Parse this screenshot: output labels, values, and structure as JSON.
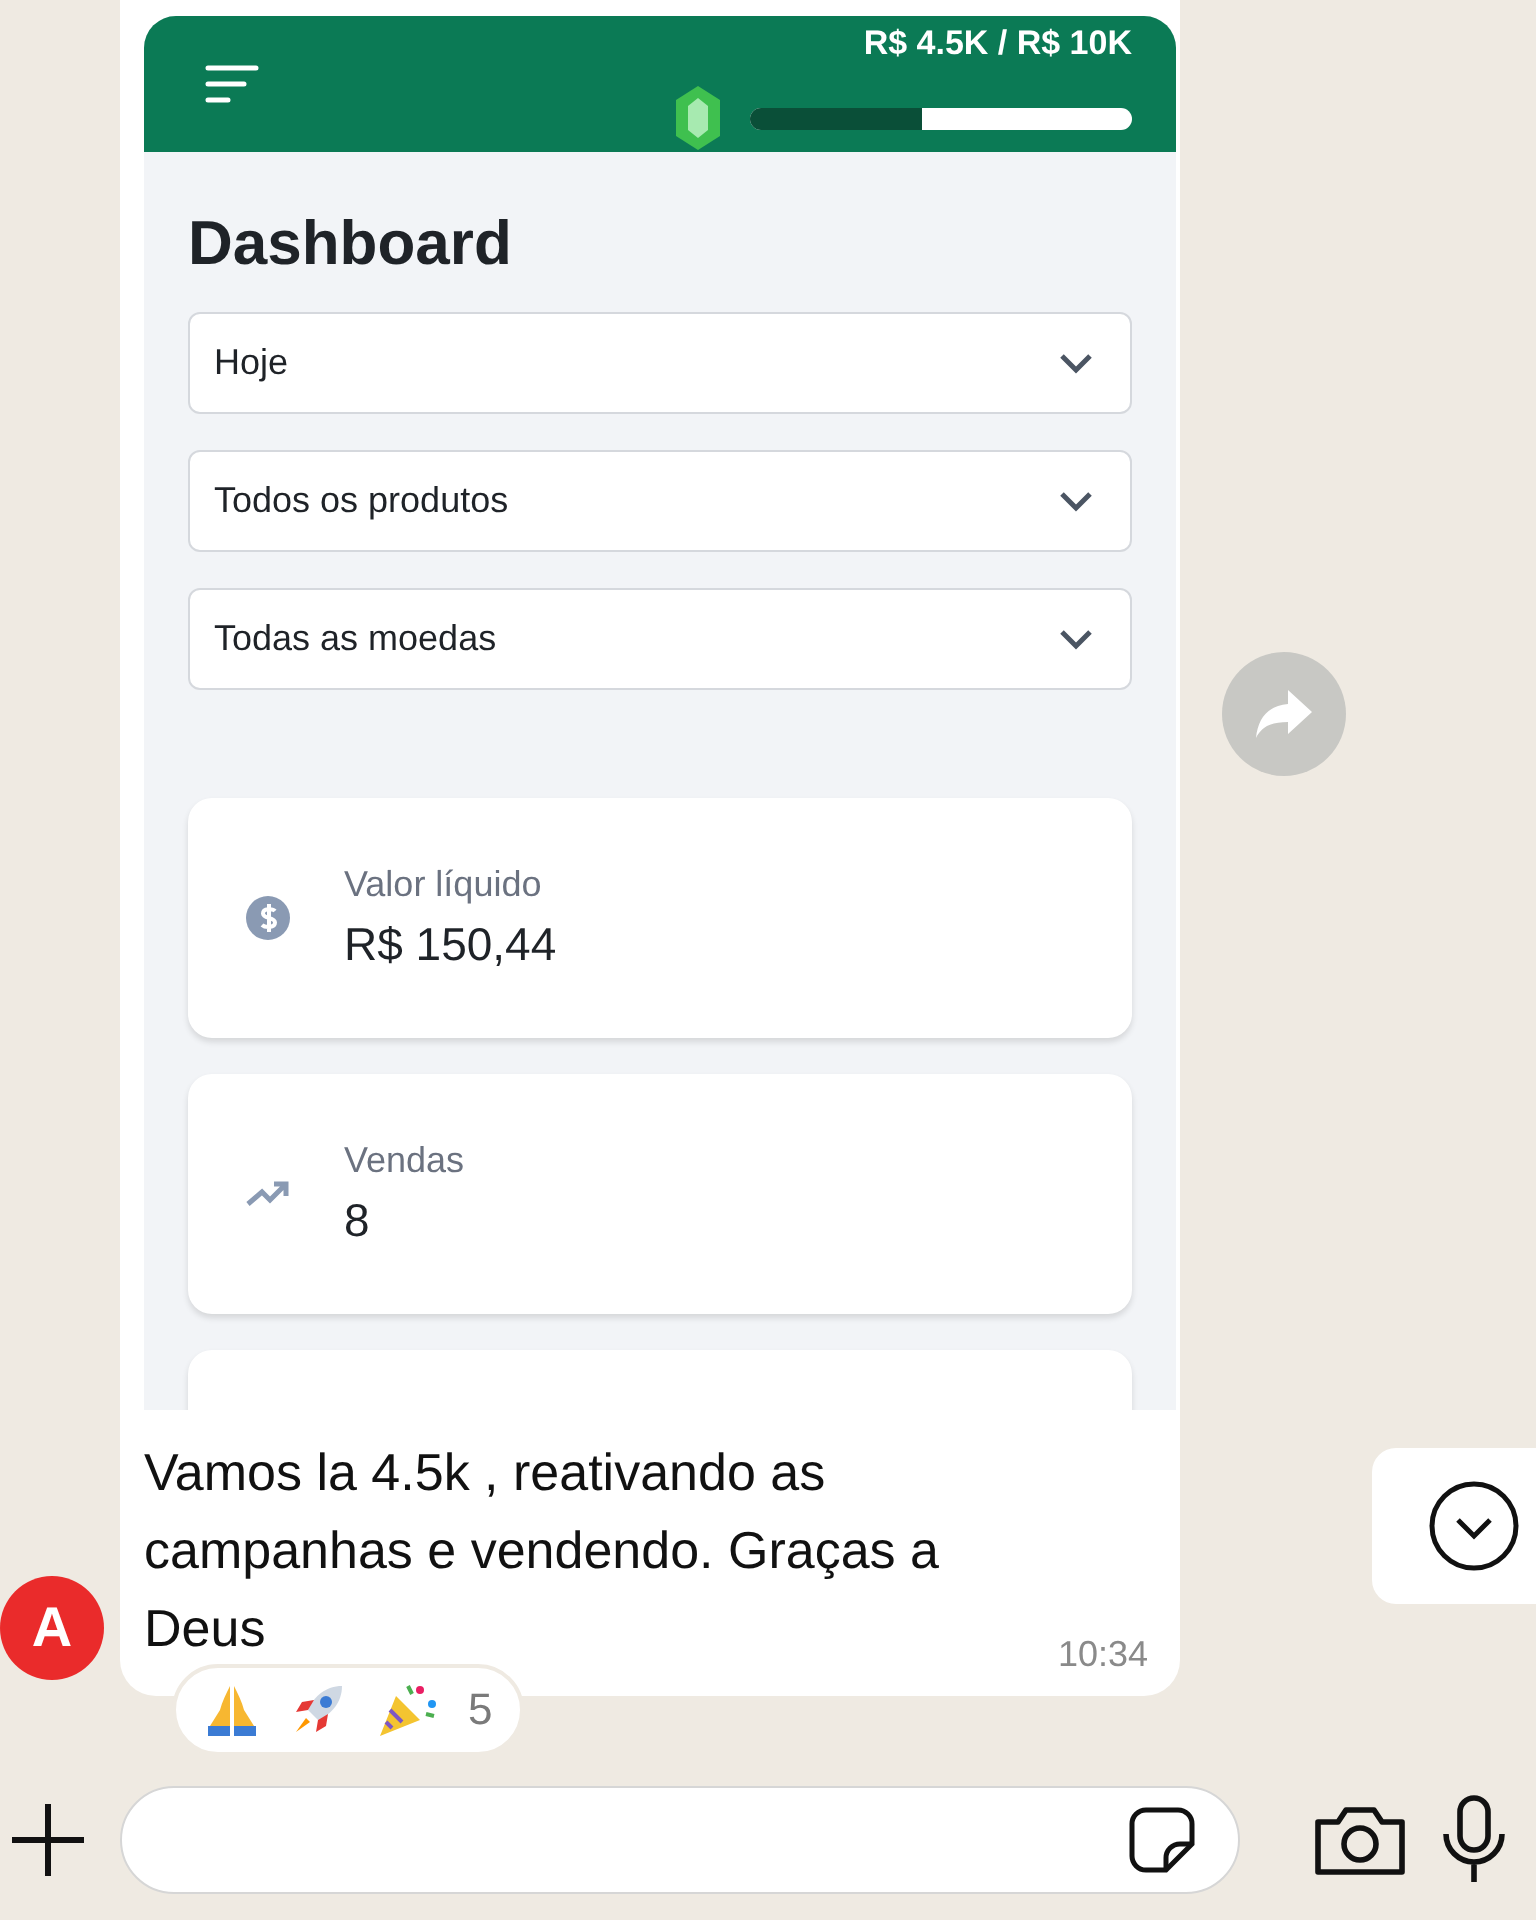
{
  "dashboard": {
    "goal": {
      "label": "R$ 4.5K / R$ 10K",
      "level": 0.45
    },
    "title": "Dashboard",
    "filters": [
      {
        "value": "Hoje"
      },
      {
        "value": "Todos os produtos"
      },
      {
        "value": "Todas as moedas"
      }
    ],
    "stats": [
      {
        "kind": "money",
        "label": "Valor líquido",
        "value": "R$ 150,44"
      },
      {
        "kind": "trend",
        "label": "Vendas",
        "value": "8"
      }
    ]
  },
  "message": {
    "sender_initial": "A",
    "text": "Vamos la 4.5k , reativando as campanhas e vendendo. Graças a Deus",
    "time": "10:34",
    "reaction_count": "5"
  }
}
